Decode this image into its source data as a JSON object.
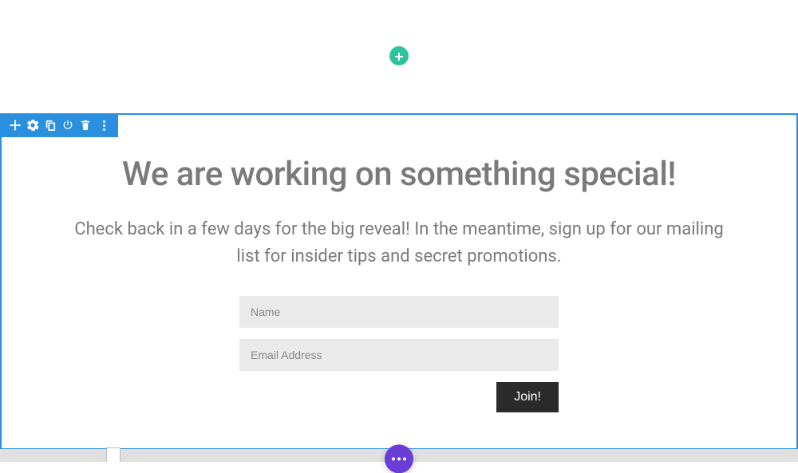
{
  "toolbar": {
    "icons": [
      "move",
      "settings",
      "duplicate",
      "save",
      "delete",
      "more"
    ]
  },
  "content": {
    "heading": "We are working on something special!",
    "subheading": "Check back in a few days for the big reveal! In the meantime, sign up for our mailing list for insider tips and secret promotions."
  },
  "form": {
    "name_placeholder": "Name",
    "email_placeholder": "Email Address",
    "submit_label": "Join!"
  },
  "colors": {
    "accent_green": "#2dc39f",
    "accent_blue": "#2a8fde",
    "accent_purple": "#6a3dd6",
    "button_dark": "#2b2b2b",
    "input_bg": "#eaeaea",
    "text_muted": "#7a7a7a"
  }
}
